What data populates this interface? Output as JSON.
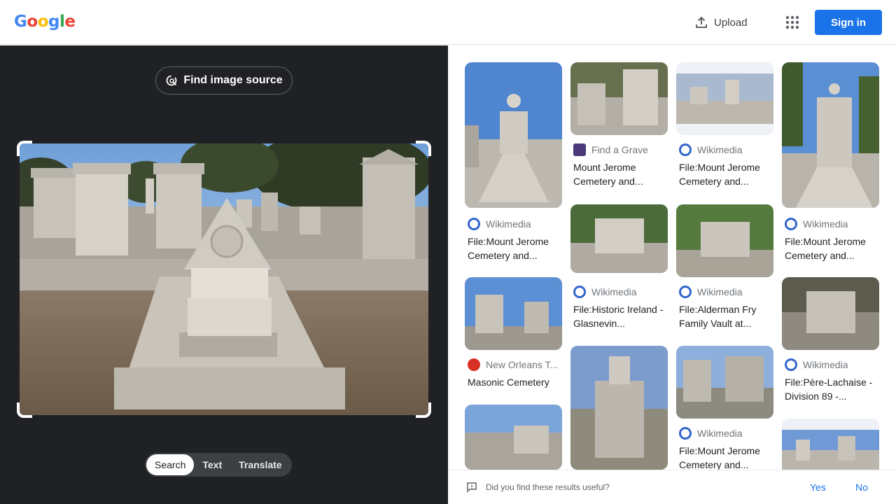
{
  "header": {
    "logo_letters": [
      "G",
      "o",
      "o",
      "g",
      "l",
      "e"
    ],
    "logo_colors": [
      "#4285f4",
      "#ea4335",
      "#fbbc05",
      "#4285f4",
      "#34a853",
      "#ea4335"
    ],
    "upload_label": "Upload",
    "apps_icon": "apps-grid-icon",
    "signin_label": "Sign in"
  },
  "left": {
    "find_source_label": "Find image source",
    "modes": [
      "Search",
      "Text",
      "Translate"
    ],
    "active_mode": "Search"
  },
  "results": [
    {
      "source": "Wikimedia",
      "title": "File:Mount Jerome Cemetery and...",
      "favicon": "wikimedia-icon"
    },
    {
      "source": "Find a Grave",
      "title": "Mount Jerome Cemetery and...",
      "favicon": "findagrave-icon"
    },
    {
      "source": "Wikimedia",
      "title": "File:Mount Jerome Cemetery and...",
      "favicon": "wikimedia-icon"
    },
    {
      "source": "Wikimedia",
      "title": "File:Mount Jerome Cemetery and...",
      "favicon": "wikimedia-icon"
    },
    {
      "source": "Wikimedia",
      "title": "File:Historic Ireland - Glasnevin...",
      "favicon": "wikimedia-icon"
    },
    {
      "source": "Wikimedia",
      "title": "File:Alderman Fry Family Vault at...",
      "favicon": "wikimedia-icon"
    },
    {
      "source": "New Orleans T...",
      "title": "Masonic Cemetery",
      "favicon": "nola-icon"
    },
    {
      "source": "Wikimedia",
      "title": "File:Père-Lachaise - Division 89 -...",
      "favicon": "wikimedia-icon"
    },
    {
      "source": "Wikimedia",
      "title": "File:Mount Jerome Cemetery and...",
      "favicon": "wikimedia-icon"
    }
  ],
  "feedback": {
    "question": "Did you find these results useful?",
    "yes_label": "Yes",
    "no_label": "No"
  }
}
